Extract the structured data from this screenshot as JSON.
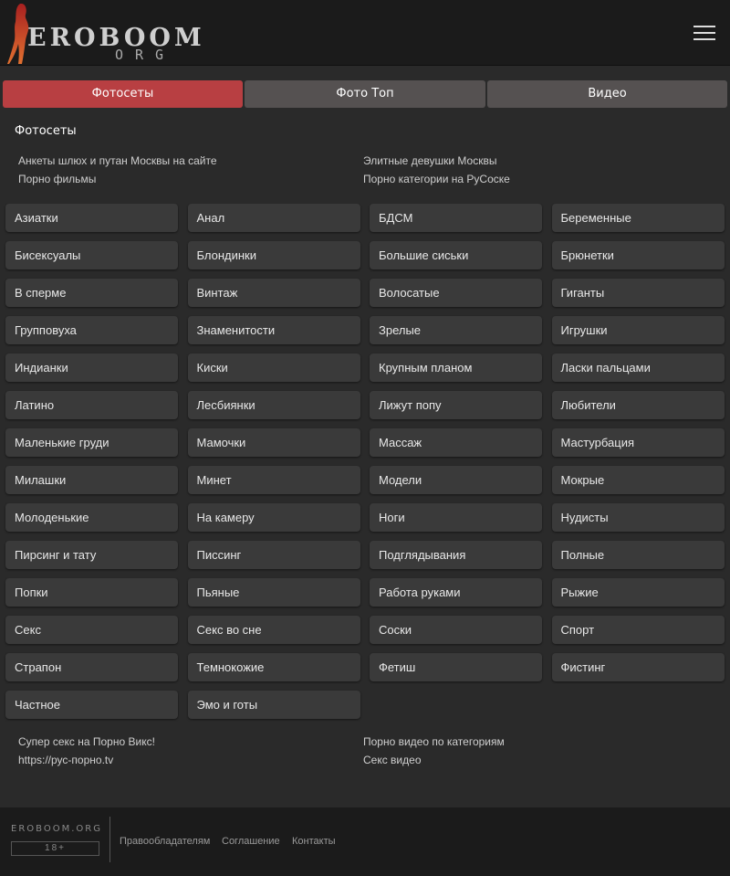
{
  "header": {
    "logo_main": "EROBOOM",
    "logo_sub": "ORG",
    "menu_icon": "hamburger-menu-icon"
  },
  "tabs": [
    {
      "label": "Фотосеты",
      "active": true
    },
    {
      "label": "Фото Топ",
      "active": false
    },
    {
      "label": "Видео",
      "active": false
    }
  ],
  "section_title": "Фотосеты",
  "top_links": [
    "Анкеты шлюх и путан Москвы на сайте",
    "Элитные девушки Москвы",
    "Порно фильмы",
    "Порно категории на РуСоске"
  ],
  "categories": [
    "Азиатки",
    "Анал",
    "БДСМ",
    "Беременные",
    "Бисексуалы",
    "Блондинки",
    "Большие сиськи",
    "Брюнетки",
    "В сперме",
    "Винтаж",
    "Волосатые",
    "Гиганты",
    "Групповуха",
    "Знаменитости",
    "Зрелые",
    "Игрушки",
    "Индианки",
    "Киски",
    "Крупным планом",
    "Ласки пальцами",
    "Латино",
    "Лесбиянки",
    "Лижут попу",
    "Любители",
    "Маленькие груди",
    "Мамочки",
    "Массаж",
    "Мастурбация",
    "Милашки",
    "Минет",
    "Модели",
    "Мокрые",
    "Молоденькие",
    "На камеру",
    "Ноги",
    "Нудисты",
    "Пирсинг и тату",
    "Писсинг",
    "Подглядывания",
    "Полные",
    "Попки",
    "Пьяные",
    "Работа руками",
    "Рыжие",
    "Секс",
    "Секс во сне",
    "Соски",
    "Спорт",
    "Страпон",
    "Темнокожие",
    "Фетиш",
    "Фистинг",
    "Частное",
    "Эмо и готы"
  ],
  "bottom_links": [
    "Супер секс на Порно Викс!",
    "Порно видео по категориям",
    "https://рус-порно.tv",
    "Секс видео"
  ],
  "footer": {
    "brand": "EROBOOM.ORG",
    "age": "18+",
    "links": [
      "Правообладателям",
      "Соглашение",
      "Контакты"
    ]
  },
  "colors": {
    "background": "#2a2a2a",
    "header_bg": "#1b1b1b",
    "active_tab": "#b83f42",
    "inactive_tab": "#555151",
    "category_bg": "#3a3a3a"
  }
}
